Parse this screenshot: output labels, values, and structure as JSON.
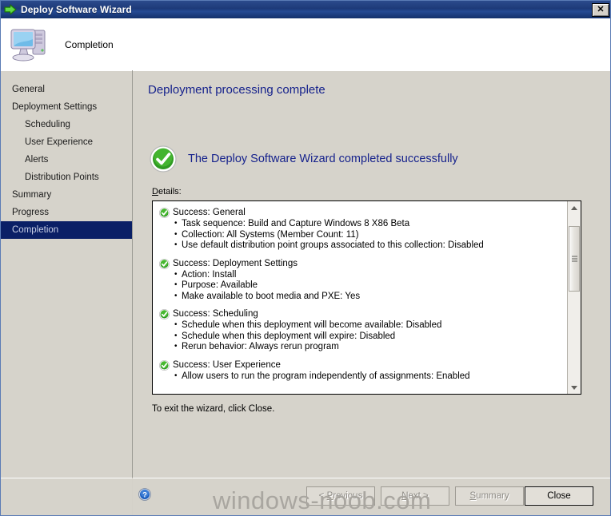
{
  "window": {
    "title": "Deploy Software Wizard",
    "title_icon": "green-right-arrow-icon",
    "close_label": "✕"
  },
  "header": {
    "icon": "computer-monitor-icon",
    "title": "Completion"
  },
  "sidebar": {
    "items": [
      {
        "label": "General",
        "sub": false,
        "selected": false
      },
      {
        "label": "Deployment Settings",
        "sub": false,
        "selected": false
      },
      {
        "label": "Scheduling",
        "sub": true,
        "selected": false
      },
      {
        "label": "User Experience",
        "sub": true,
        "selected": false
      },
      {
        "label": "Alerts",
        "sub": true,
        "selected": false
      },
      {
        "label": "Distribution Points",
        "sub": true,
        "selected": false
      },
      {
        "label": "Summary",
        "sub": false,
        "selected": false
      },
      {
        "label": "Progress",
        "sub": false,
        "selected": false
      },
      {
        "label": "Completion",
        "sub": false,
        "selected": true
      }
    ]
  },
  "content": {
    "page_heading": "Deployment processing complete",
    "success_banner": "The Deploy Software Wizard completed successfully",
    "success_icon": "green-check-circle-icon",
    "details_label_accel": "D",
    "details_label_rest": "etails:",
    "exit_note": "To exit the wizard, click Close.",
    "details": [
      {
        "icon": "green-check-circle-icon",
        "title": "Success: General",
        "items": [
          "Task sequence: Build and Capture Windows 8 X86 Beta",
          "Collection: All Systems (Member Count: 11)",
          "Use default distribution point groups associated to this collection: Disabled"
        ]
      },
      {
        "icon": "green-check-circle-icon",
        "title": "Success: Deployment Settings",
        "items": [
          "Action: Install",
          "Purpose: Available",
          "Make available to boot media and PXE: Yes"
        ]
      },
      {
        "icon": "green-check-circle-icon",
        "title": "Success: Scheduling",
        "items": [
          "Schedule when this deployment will become available: Disabled",
          "Schedule when this deployment will expire: Disabled",
          "Rerun behavior: Always rerun program"
        ]
      },
      {
        "icon": "green-check-circle-icon",
        "title": "Success: User Experience",
        "items": [
          "Allow users to run the program independently of assignments: Enabled"
        ]
      }
    ],
    "scrollbar": {
      "up_arrow": "scroll-up-arrow-icon",
      "down_arrow": "scroll-down-arrow-icon",
      "thumb_top_pct": 7,
      "thumb_height_pct": 39
    }
  },
  "footer": {
    "help_icon": "blue-question-help-icon",
    "buttons": [
      {
        "name": "previous",
        "prefix": "< ",
        "accel": "P",
        "rest": "revious",
        "enabled": false
      },
      {
        "name": "next",
        "prefix": "",
        "accel": "N",
        "rest": "ext >",
        "enabled": false
      },
      {
        "name": "summary",
        "prefix": "",
        "accel": "S",
        "rest": "ummary",
        "enabled": false
      },
      {
        "name": "close",
        "prefix": "",
        "accel": "",
        "rest": "Close",
        "enabled": true
      }
    ]
  },
  "watermark": {
    "text": "windows-noob.com"
  },
  "colors": {
    "titlebar_blue": "#1d3a78",
    "heading_blue": "#16228c",
    "selection_navy": "#0a1f66",
    "dialog_face": "#d6d3cb",
    "success_green": "#3ba32e"
  }
}
